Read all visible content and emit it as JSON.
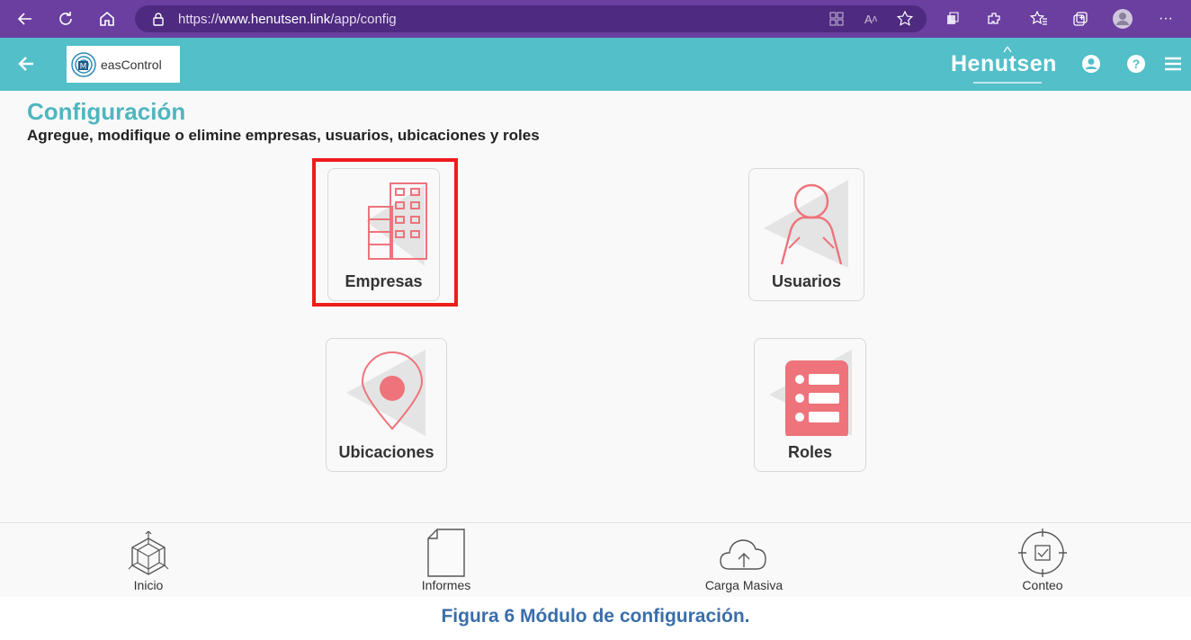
{
  "browser": {
    "url_prefix": "https://",
    "url_domain": "www.henutsen.link",
    "url_path": "/app/config"
  },
  "header": {
    "logo_text": "easControl",
    "brand": "Henutsen"
  },
  "page": {
    "title": "Configuración",
    "subtitle": "Agregue, modifique o elimine empresas, usuarios,  ubicaciones y roles"
  },
  "tiles": {
    "empresas": "Empresas",
    "usuarios": "Usuarios",
    "ubicaciones": "Ubicaciones",
    "roles": "Roles"
  },
  "bottom_nav": {
    "inicio": "Inicio",
    "informes": "Informes",
    "carga_masiva": "Carga Masiva",
    "conteo": "Conteo"
  },
  "caption": "Figura 6 Módulo de configuración.",
  "colors": {
    "browser_bar": "#6a3fa0",
    "header": "#52bfc9",
    "title": "#4fb6bf",
    "icon_accent": "#ee737b",
    "highlight": "#ee1c1c",
    "caption": "#3a6eaa"
  },
  "icons": [
    "back-icon",
    "refresh-icon",
    "home-icon",
    "lock-icon",
    "user-account-icon",
    "help-icon",
    "menu-icon",
    "building-icon",
    "person-icon",
    "location-pin-icon",
    "list-icon",
    "cube-icon",
    "document-icon",
    "cloud-upload-icon",
    "target-check-icon"
  ]
}
